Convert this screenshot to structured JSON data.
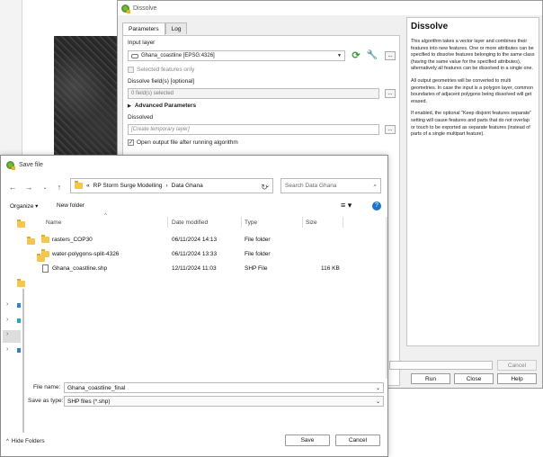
{
  "dissolve": {
    "title": "Dissolve",
    "tabs": [
      "Parameters",
      "Log"
    ],
    "input_layer_label": "Input layer",
    "input_layer_value": "Ghana_coastline [EPSG:4326]",
    "selected_only_label": "Selected features only",
    "dissolve_fields_label": "Dissolve field(s) [optional]",
    "dissolve_fields_value": "0 field(s) selected",
    "advanced_label": "Advanced Parameters",
    "dissolved_label": "Dissolved",
    "dissolved_placeholder": "[Create temporary layer]",
    "open_output_label": "Open output file after running algorithm",
    "more_button": "...",
    "cancel_button": "Cancel",
    "run_button": "Run",
    "close_button": "Close",
    "help_button": "Help",
    "help": {
      "title": "Dissolve",
      "p1": "This algorithm takes a vector layer and combines their features into new features. One or more attributes can be specified to dissolve features belonging to the same class (having the same value for the specified attributes), alternatively all features can be dissolved in a single one.",
      "p2": "All output geometries will be converted to multi geometries. In case the input is a polygon layer, common boundaries of adjacent polygons being dissolved will get erased.",
      "p3": "If enabled, the optional \"Keep disjoint features separate\" setting will cause features and parts that do not overlap or touch to be exported as separate features (instead of parts of a single multipart feature)."
    }
  },
  "save": {
    "title": "Save file",
    "breadcrumb_prefix": "«",
    "breadcrumb": [
      "RP Storm Surge Modelling",
      "Data Ghana"
    ],
    "search_placeholder": "Search Data Ghana",
    "organize": "Organize",
    "new_folder": "New folder",
    "columns": [
      "Name",
      "Date modified",
      "Type",
      "Size"
    ],
    "rows": [
      {
        "name": "rasters_COP30",
        "date": "06/11/2024 14:13",
        "type": "File folder",
        "size": "",
        "kind": "folder"
      },
      {
        "name": "water-polygons-split-4326",
        "date": "06/11/2024 13:33",
        "type": "File folder",
        "size": "",
        "kind": "folder"
      },
      {
        "name": "Ghana_coastline.shp",
        "date": "12/11/2024 11:03",
        "type": "SHP File",
        "size": "116 KB",
        "kind": "file"
      }
    ],
    "file_name_label": "File name:",
    "file_name_value": "Ghana_coastline_final",
    "save_as_label": "Save as type:",
    "save_as_value": "SHP files (*.shp)",
    "hide_folders": "Hide Folders",
    "save_button": "Save",
    "cancel_button": "Cancel"
  },
  "colors": {
    "accent": "#1a73c9",
    "folder": "#f3c650"
  }
}
